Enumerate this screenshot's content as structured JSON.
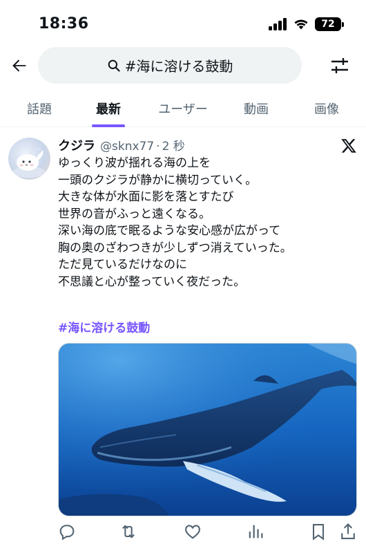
{
  "status_bar": {
    "time": "18:36",
    "battery": "72"
  },
  "search": {
    "query": "#海に溶ける鼓動"
  },
  "tabs": [
    {
      "label": "話題",
      "active": false
    },
    {
      "label": "最新",
      "active": true
    },
    {
      "label": "ユーザー",
      "active": false
    },
    {
      "label": "動画",
      "active": false
    },
    {
      "label": "画像",
      "active": false
    }
  ],
  "post": {
    "author_name": "クジラ",
    "author_handle": "@sknx77",
    "separator": "·",
    "time": "2 秒",
    "lines": [
      "ゆっくり波が揺れる海の上を",
      "一頭のクジラが静かに横切っていく。",
      "大きな体が水面に影を落とすたび",
      "世界の音がふっと遠くなる。",
      "深い海の底で眠るような安心感が広がって",
      "胸の奥のざわつきが少しずつ消えていった。",
      "ただ見ているだけなのに",
      "不思議と心が整っていく夜だった。"
    ],
    "hashtag": "#海に溶ける鼓動"
  },
  "colors": {
    "accent": "#7856ff",
    "text_primary": "#0f1419",
    "text_secondary": "#536471",
    "search_bg": "#eff3f4"
  },
  "icons": {
    "back": "arrow-left-icon",
    "search": "search-icon",
    "filter": "sliders-icon",
    "logo": "x-logo-icon",
    "actions": [
      "reply-icon",
      "retweet-icon",
      "like-icon",
      "views-icon",
      "bookmark-icon",
      "share-icon"
    ]
  }
}
